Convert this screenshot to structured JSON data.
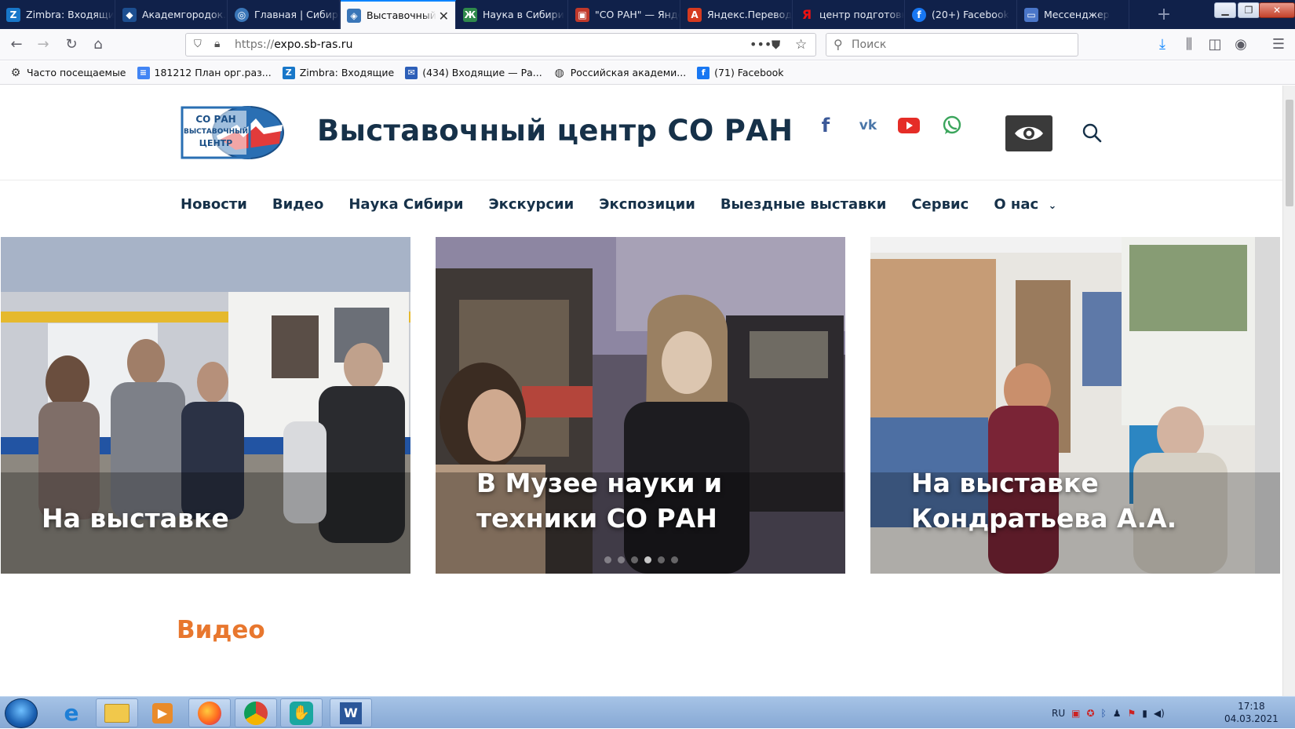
{
  "browser": {
    "tabs": [
      {
        "title": "Zimbra: Входящи",
        "icon": "zimbra-icon",
        "color": "#1877c9"
      },
      {
        "title": "Академгородок.",
        "icon": "academ-icon",
        "color": "#1d4f91"
      },
      {
        "title": "Главная | Сибирс",
        "icon": "globe-icon",
        "color": "#3a76b8"
      },
      {
        "title": "Выставочный",
        "icon": "expo-icon",
        "color": "#3a76b8",
        "active": true
      },
      {
        "title": "Наука в Сибири",
        "icon": "nauka-icon",
        "color": "#2f8a4b"
      },
      {
        "title": "\"СО РАН\" — Янде",
        "icon": "yandex-icon",
        "color": "#c0392b"
      },
      {
        "title": "Яндекс.Перевод",
        "icon": "translate-icon",
        "color": "#d63a1f"
      },
      {
        "title": "центр подготовк",
        "icon": "yandex-ya-icon",
        "color": "#e11"
      },
      {
        "title": "(20+) Facebook",
        "icon": "facebook-icon",
        "color": "#1877f2"
      },
      {
        "title": "Мессенджер",
        "icon": "messenger-icon",
        "color": "#4a76c9"
      }
    ],
    "url": "https://expo.sb-ras.ru",
    "url_host": "expo.sb-ras.ru",
    "search_placeholder": "Поиск",
    "bookmarks": [
      {
        "label": "Часто посещаемые",
        "icon": "gear-icon"
      },
      {
        "label": "181212 План орг.раз...",
        "icon": "docs-icon"
      },
      {
        "label": "Zimbra: Входящие",
        "icon": "zimbra-icon"
      },
      {
        "label": "(434) Входящие — Ра...",
        "icon": "mail-icon"
      },
      {
        "label": "Российская академи...",
        "icon": "globe-icon"
      },
      {
        "label": "(71) Facebook",
        "icon": "facebook-icon"
      }
    ]
  },
  "site": {
    "title": "Выставочный центр СО РАН",
    "logo_text": [
      "СО РАН",
      "ВЫСТАВОЧНЫЙ",
      "ЦЕНТР"
    ],
    "social": [
      "facebook-icon",
      "vk-icon",
      "youtube-icon",
      "whatsapp-icon"
    ],
    "nav": [
      "Новости",
      "Видео",
      "Наука Сибири",
      "Экскурсии",
      "Экспозиции",
      "Выездные выставки",
      "Сервис",
      "О нас"
    ],
    "slides": [
      {
        "caption": "На выставке"
      },
      {
        "caption": "В Музее науки и техники СО РАН"
      },
      {
        "caption": "На выставке Кондратьева А.А."
      }
    ],
    "slide_count": 6,
    "active_slide": 4,
    "section_heading": "Видео",
    "colors": {
      "title": "#163149",
      "accent": "#e8772e"
    }
  },
  "taskbar": {
    "apps": [
      "ie-icon",
      "explorer-icon",
      "media-player-icon",
      "firefox-icon",
      "chrome-icon",
      "paw-app-icon",
      "word-icon"
    ],
    "lang": "RU",
    "time": "17:18",
    "date": "04.03.2021"
  }
}
